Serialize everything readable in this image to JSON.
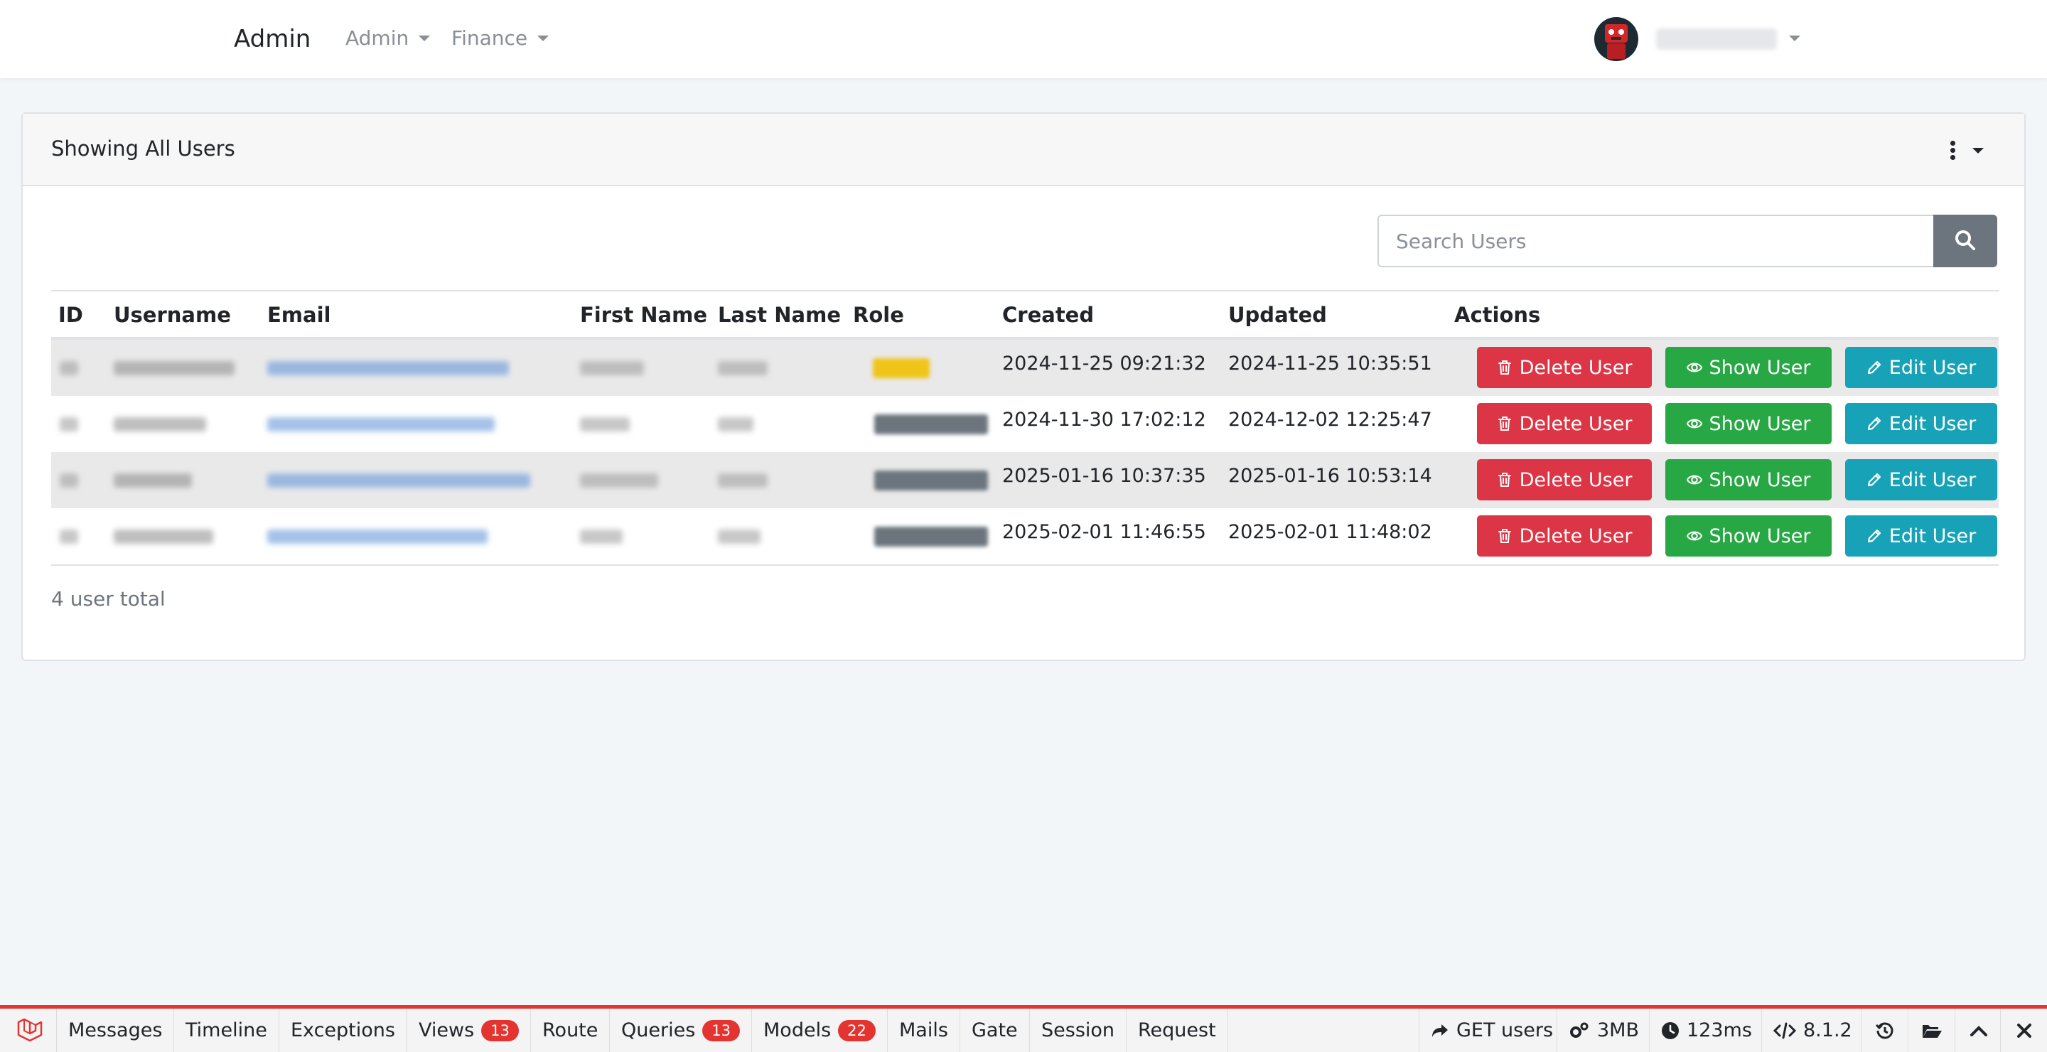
{
  "navbar": {
    "brand": "Admin",
    "menus": [
      {
        "label": "Admin"
      },
      {
        "label": "Finance"
      }
    ]
  },
  "card": {
    "title": "Showing All Users"
  },
  "search": {
    "placeholder": "Search Users",
    "button_icon": "search-icon"
  },
  "table": {
    "headers": [
      "ID",
      "Username",
      "Email",
      "First Name",
      "Last Name",
      "Role",
      "Created",
      "Updated",
      "Actions"
    ],
    "rows": [
      {
        "created": "2024-11-25 09:21:32",
        "updated": "2024-11-25 10:35:51",
        "role_color": "#f0c419"
      },
      {
        "created": "2024-11-30 17:02:12",
        "updated": "2024-12-02 12:25:47",
        "role_color": "#6c757d"
      },
      {
        "created": "2025-01-16 10:37:35",
        "updated": "2025-01-16 10:53:14",
        "role_color": "#6c757d"
      },
      {
        "created": "2025-02-01 11:46:55",
        "updated": "2025-02-01 11:48:02",
        "role_color": "#6c757d"
      }
    ],
    "actions": {
      "delete_label": "Delete User",
      "show_label": "Show User",
      "edit_label": "Edit User"
    }
  },
  "total_text": "4 user total",
  "colors": {
    "danger": "#dc3545",
    "success": "#28a745",
    "info": "#17a2b8",
    "secondary": "#6c757d",
    "debugbar_accent": "#e3342f"
  },
  "debugbar": {
    "tabs": [
      {
        "label": "Messages"
      },
      {
        "label": "Timeline"
      },
      {
        "label": "Exceptions"
      },
      {
        "label": "Views",
        "badge": "13"
      },
      {
        "label": "Route"
      },
      {
        "label": "Queries",
        "badge": "13"
      },
      {
        "label": "Models",
        "badge": "22"
      },
      {
        "label": "Mails"
      },
      {
        "label": "Gate"
      },
      {
        "label": "Session"
      },
      {
        "label": "Request"
      }
    ],
    "request": "GET users",
    "memory": "3MB",
    "time": "123ms",
    "php_version": "8.1.2"
  }
}
